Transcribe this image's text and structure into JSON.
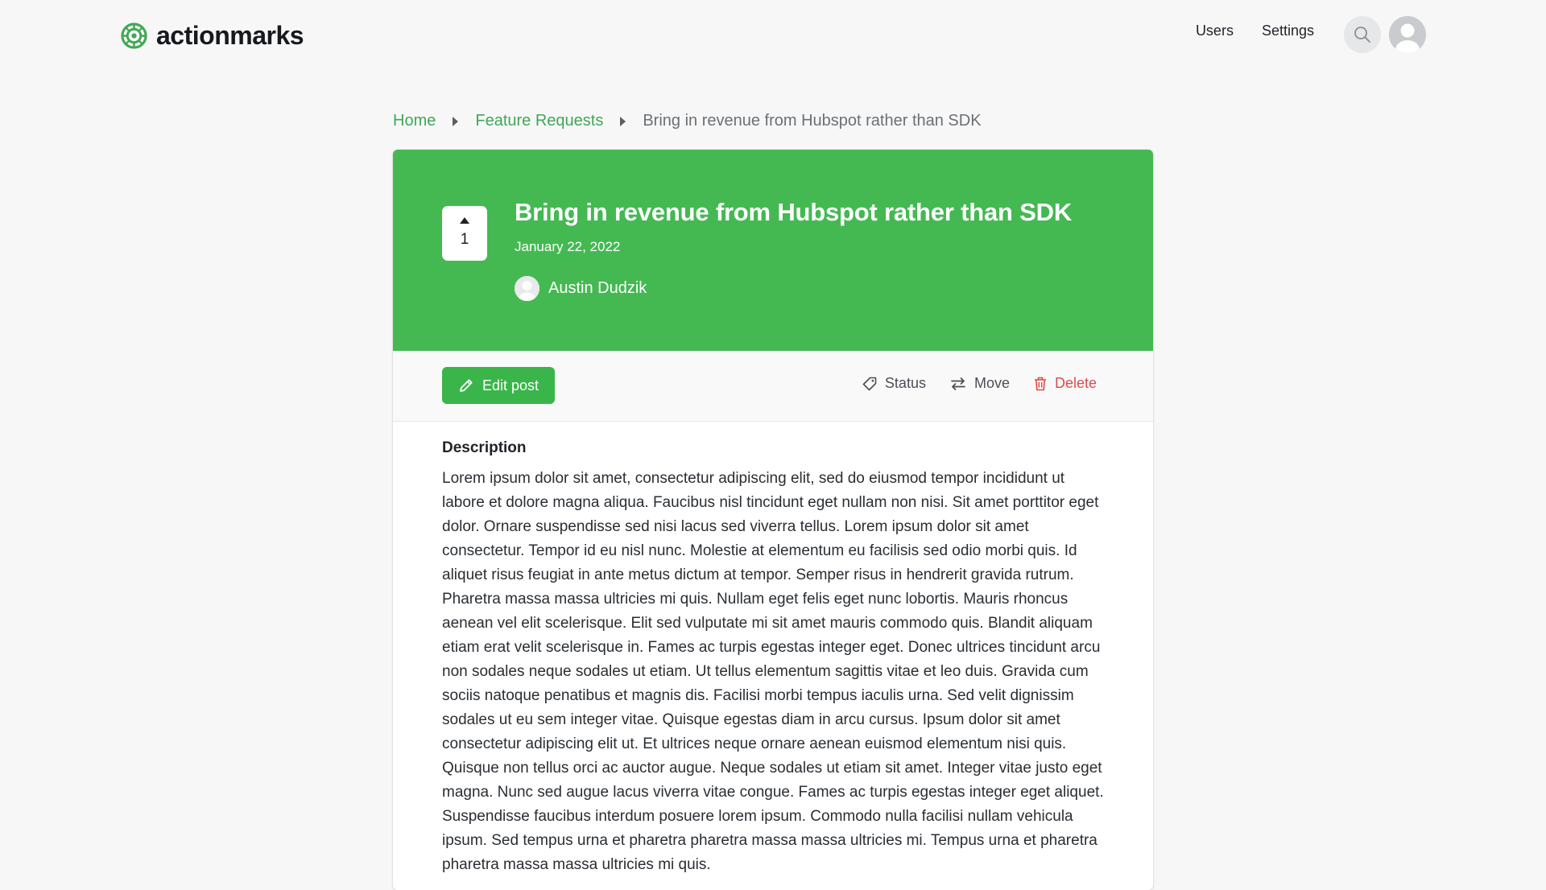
{
  "brand": {
    "name": "actionmarks",
    "color": "#3fa855"
  },
  "nav": {
    "links": [
      "Users",
      "Settings"
    ],
    "search_icon": "search-icon",
    "avatar_icon": "user-avatar-icon"
  },
  "breadcrumb": {
    "items": [
      "Home",
      "Feature Requests"
    ],
    "current": "Bring in revenue from Hubspot rather than SDK"
  },
  "post": {
    "votes": "1",
    "title": "Bring in revenue from Hubspot rather than SDK",
    "date": "January 22, 2022",
    "author": "Austin Dudzik",
    "header_color": "#44b952"
  },
  "toolbar": {
    "edit_label": "Edit post",
    "status_label": "Status",
    "move_label": "Move",
    "delete_label": "Delete",
    "danger_color": "#e04a4a"
  },
  "description": {
    "heading": "Description",
    "body": "Lorem ipsum dolor sit amet, consectetur adipiscing elit, sed do eiusmod tempor incididunt ut labore et dolore magna aliqua. Faucibus nisl tincidunt eget nullam non nisi. Sit amet porttitor eget dolor. Ornare suspendisse sed nisi lacus sed viverra tellus. Lorem ipsum dolor sit amet consectetur. Tempor id eu nisl nunc. Molestie at elementum eu facilisis sed odio morbi quis. Id aliquet risus feugiat in ante metus dictum at tempor. Semper risus in hendrerit gravida rutrum. Pharetra massa massa ultricies mi quis. Nullam eget felis eget nunc lobortis. Mauris rhoncus aenean vel elit scelerisque. Elit sed vulputate mi sit amet mauris commodo quis. Blandit aliquam etiam erat velit scelerisque in. Fames ac turpis egestas integer eget. Donec ultrices tincidunt arcu non sodales neque sodales ut etiam. Ut tellus elementum sagittis vitae et leo duis. Gravida cum sociis natoque penatibus et magnis dis. Facilisi morbi tempus iaculis urna. Sed velit dignissim sodales ut eu sem integer vitae. Quisque egestas diam in arcu cursus. Ipsum dolor sit amet consectetur adipiscing elit ut. Et ultrices neque ornare aenean euismod elementum nisi quis. Quisque non tellus orci ac auctor augue. Neque sodales ut etiam sit amet. Integer vitae justo eget magna. Nunc sed augue lacus viverra vitae congue. Fames ac turpis egestas integer eget aliquet. Suspendisse faucibus interdum posuere lorem ipsum. Commodo nulla facilisi nullam vehicula ipsum. Sed tempus urna et pharetra pharetra massa massa ultricies mi. Tempus urna et pharetra pharetra massa massa ultricies mi quis."
  }
}
